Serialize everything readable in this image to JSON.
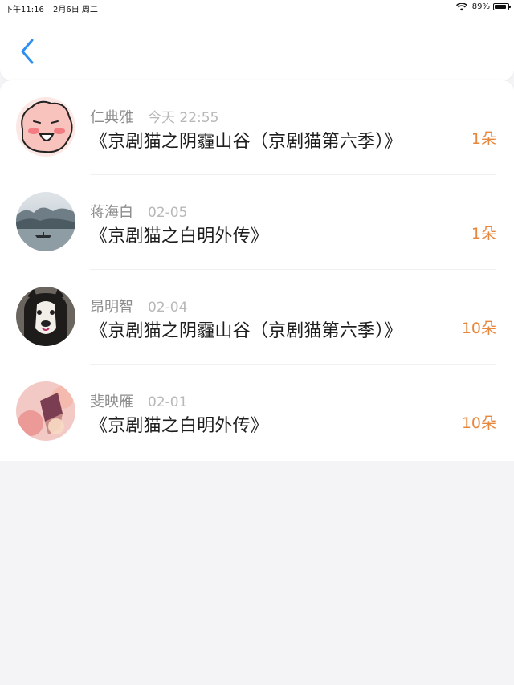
{
  "status_bar": {
    "time": "下午11:16",
    "date": "2月6日 周二",
    "battery": "89%",
    "battery_level": 0.89
  },
  "nav": {
    "back_icon": "chevron-left-icon",
    "accent_color": "#2f8ff0"
  },
  "colors": {
    "amount": "#e8873c",
    "name": "#8c8c8c",
    "time": "#b8b8b8"
  },
  "records": [
    {
      "name": "仁典雅",
      "time": "今天 22:55",
      "title": "《京剧猫之阴霾山谷（京剧猫第六季）》",
      "amount": "1朵",
      "avatar": "cartoon-face-avatar"
    },
    {
      "name": "蒋海白",
      "time": "02-05",
      "title": "《京剧猫之白明外传》",
      "amount": "1朵",
      "avatar": "misty-lake-avatar"
    },
    {
      "name": "昂明智",
      "time": "02-04",
      "title": "《京剧猫之阴霾山谷（京剧猫第六季）》",
      "amount": "10朵",
      "avatar": "husky-dog-avatar"
    },
    {
      "name": "斐映雁",
      "time": "02-01",
      "title": "《京剧猫之白明外传》",
      "amount": "10朵",
      "avatar": "pink-flower-avatar"
    }
  ]
}
